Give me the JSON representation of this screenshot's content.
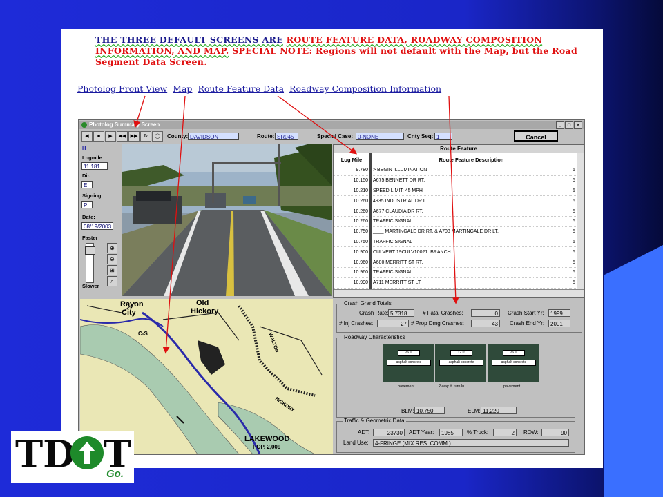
{
  "note": {
    "part1": "THE THREE DEFAULT SCREENS ARE",
    "part2": "ROUTE FEATURE DATA, ROADWAY COMPOSITION INFORMATION, AND MAP.",
    "part3": "SPECIAL NOTE:",
    "part4": "Regions will not default with the Map, but the Road Segment Data Screen."
  },
  "links": [
    "Photolog Front View",
    "Map",
    "Route Feature Data",
    "Roadway Composition Information"
  ],
  "window": {
    "title": "Photolog Summary Screen",
    "controls": {
      "minimize": "_",
      "restore": "□",
      "close": "×"
    },
    "county_label": "County:",
    "county": "DAVIDSON",
    "route_label": "Route:",
    "route": "SR045",
    "special_label": "Special Case:",
    "special": "0-NONE",
    "cnty_label": "Cnty Seq:",
    "cnty": "1",
    "cancel": "Cancel",
    "toolbar": [
      "◀",
      "■",
      "▶",
      "◀◀",
      "▶▶",
      "↻",
      "◯"
    ],
    "direction_flag": "H",
    "logmile_label": "Logmile:",
    "logmile": "11.181",
    "dir_label": "Dir.:",
    "dir": "E",
    "signing_label": "Signing:",
    "signing": "P",
    "date_label": "Date:",
    "date": "08/19/2003",
    "faster": "Faster",
    "slower": "Slower",
    "zoom_glyphs": [
      "⊕",
      "⊖",
      "⊞",
      "⌕"
    ]
  },
  "route_feature": {
    "title": "Route Feature",
    "col1": "Log Mile",
    "col2": "Route Feature Description",
    "rows": [
      [
        "9.780",
        "> BEGIN ILLUMINATION"
      ],
      [
        "10.150",
        "A675 BENNETT DR RT."
      ],
      [
        "10.210",
        "SPEED LIMIT:  45 MPH"
      ],
      [
        "10.260",
        "4935 INDUSTRIAL DR LT."
      ],
      [
        "10.260",
        "A677 CLAUDIA DR RT."
      ],
      [
        "10.260",
        "TRAFFIC SIGNAL"
      ],
      [
        "10.750",
        "____ MARTINGALE DR RT. & A703 MARTINGALE DR LT."
      ],
      [
        "10.750",
        "TRAFFIC SIGNAL"
      ],
      [
        "10.900",
        "CULVERT 19CULV10021:  BRANCH"
      ],
      [
        "10.960",
        "A680 MERRITT ST RT."
      ],
      [
        "10.960",
        "TRAFFIC SIGNAL"
      ],
      [
        "10.990",
        "A711 MERRITT ST LT."
      ]
    ],
    "extra": "5"
  },
  "crash": {
    "title": "Crash Grand Totals",
    "rate_label": "Crash Rate:",
    "rate": "5.7318",
    "fatal_label": "# Fatal Crashes:",
    "fatal": "0",
    "start_label": "Crash Start Yr:",
    "start": "1999",
    "inj_label": "# Inj Crashes:",
    "inj": "27",
    "prop_label": "# Prop Dmg Crashes:",
    "prop": "43",
    "end_label": "Crash End Yr:",
    "end": "2001"
  },
  "roadway": {
    "title": "Roadway Characteristics",
    "lanes": [
      {
        "width": "26.0'",
        "surface": "asphalt concrete",
        "label": "pavement"
      },
      {
        "width": "12.0'",
        "surface": "asphalt concrete",
        "label": "2-way lt.  turn ln."
      },
      {
        "width": "26.0'",
        "surface": "asphalt concrete",
        "label": "pavement"
      }
    ],
    "blm_label": "BLM:",
    "blm": "10.750",
    "elm_label": "ELM:",
    "elm": "11.220"
  },
  "traffic": {
    "title": "Traffic & Geometric Data",
    "adt_label": "ADT:",
    "adt": "23730",
    "year_label": "ADT Year:",
    "year": "1985",
    "truck_label": "% Truck:",
    "truck": "2",
    "row_label": "ROW:",
    "row": "90",
    "land_label": "Land Use:",
    "land": "4-FRINGE (MIX RES. COMM.)"
  },
  "map_labels": {
    "rayon": "Rayon",
    "city": "City",
    "old": "Old",
    "hickory": "Hickory",
    "lakewood": "LAKEWOOD",
    "pop": "POP. 2,009",
    "walton": "WALTON",
    "river": "HICKORY",
    "cs": "C-S"
  },
  "logo": {
    "td": "TD",
    "t": "T",
    "go": "Go."
  },
  "colors": {
    "slide_bg": "#1e2bd8",
    "note_blue": "#1a1a8c",
    "note_red": "#e01010",
    "logo_green": "#1e8a2a"
  }
}
